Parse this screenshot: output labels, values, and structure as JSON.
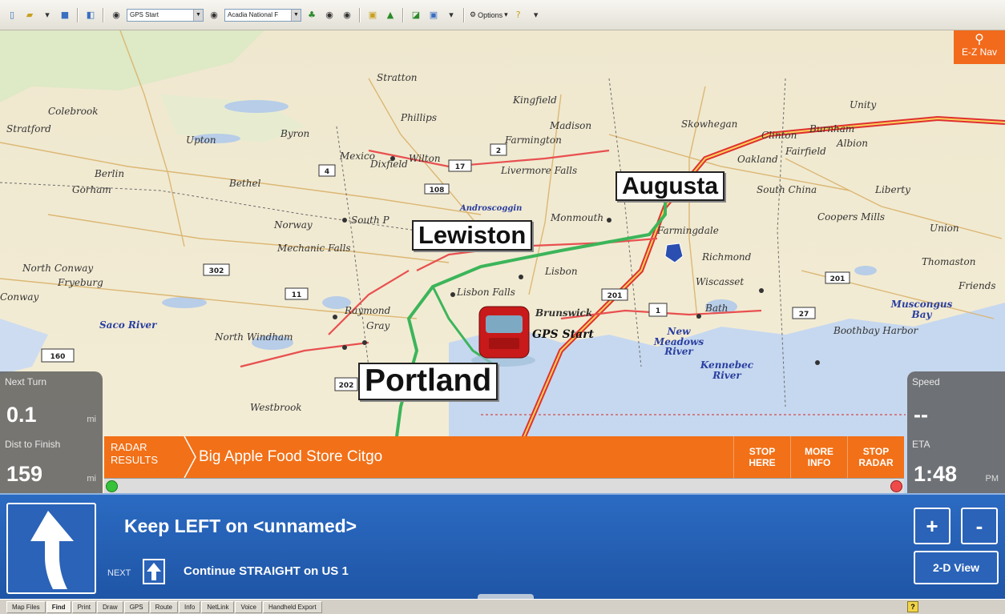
{
  "toolbar": {
    "gps_select": "GPS Start",
    "map_select": "Acadia National F",
    "options_label": "Options"
  },
  "map": {
    "ez_nav_label": "E-Z Nav",
    "cities": [
      "Augusta",
      "Lewiston",
      "Portland"
    ],
    "towns": [
      {
        "name": "Stratton"
      },
      {
        "name": "Kingfield"
      },
      {
        "name": "Phillips"
      },
      {
        "name": "Madison"
      },
      {
        "name": "Skowhegan"
      },
      {
        "name": "Farmington"
      },
      {
        "name": "Wilton"
      },
      {
        "name": "Dixfield"
      },
      {
        "name": "Livermore Falls"
      },
      {
        "name": "Mexico"
      },
      {
        "name": "Byron"
      },
      {
        "name": "Upton"
      },
      {
        "name": "Bethel"
      },
      {
        "name": "Gorham"
      },
      {
        "name": "Berlin"
      },
      {
        "name": "Norway"
      },
      {
        "name": "South P"
      },
      {
        "name": "Mechanic Falls"
      },
      {
        "name": "Monmouth"
      },
      {
        "name": "Farmingdale"
      },
      {
        "name": "Richmond"
      },
      {
        "name": "Lisbon"
      },
      {
        "name": "Lisbon Falls"
      },
      {
        "name": "Wiscasset"
      },
      {
        "name": "Raymond"
      },
      {
        "name": "Gray"
      },
      {
        "name": "North Windham"
      },
      {
        "name": "Bath"
      },
      {
        "name": "Boothbay Harbor"
      },
      {
        "name": "Westbrook"
      },
      {
        "name": "North Conway"
      },
      {
        "name": "Fryeburg"
      },
      {
        "name": "Conway"
      },
      {
        "name": "Colebrook"
      },
      {
        "name": "Oakland"
      },
      {
        "name": "Fairfield"
      },
      {
        "name": "Albion"
      },
      {
        "name": "South China"
      },
      {
        "name": "Liberty"
      },
      {
        "name": "Coopers Mills"
      },
      {
        "name": "Union"
      },
      {
        "name": "Thomaston"
      },
      {
        "name": "Friends"
      },
      {
        "name": "Unity"
      },
      {
        "name": "Clinton"
      },
      {
        "name": "Burnham"
      },
      {
        "name": "Stratford"
      },
      {
        "name": "Brunswick"
      }
    ],
    "water": [
      {
        "name": "Saco River"
      },
      {
        "name": "Androscoggin"
      },
      {
        "name": "New Meadows River"
      },
      {
        "name": "Kennebec River"
      },
      {
        "name": "Muscongus Bay"
      }
    ],
    "gps_marker_label": "GPS Start",
    "shields": [
      "302",
      "11",
      "202",
      "201",
      "1",
      "27",
      "160",
      "4",
      "17",
      "108",
      "2",
      "201"
    ]
  },
  "panels": {
    "next_turn": {
      "label": "Next Turn",
      "value": "0.1",
      "unit": "mi"
    },
    "dist_to_finish": {
      "label": "Dist to Finish",
      "value": "159",
      "unit": "mi"
    },
    "speed": {
      "label": "Speed",
      "value": "--"
    },
    "eta": {
      "label": "ETA",
      "value": "1:48",
      "unit": "PM"
    }
  },
  "radar": {
    "title_line1": "RADAR",
    "title_line2": "RESULTS",
    "result_name": "Big Apple Food Store Citgo",
    "buttons": [
      {
        "line1": "STOP",
        "line2": "HERE"
      },
      {
        "line1": "MORE",
        "line2": "INFO"
      },
      {
        "line1": "STOP",
        "line2": "RADAR"
      }
    ]
  },
  "directions": {
    "instruction": "Keep LEFT on <unnamed>",
    "next_label": "NEXT",
    "next_instruction": "Continue STRAIGHT on US 1",
    "zoom_in": "+",
    "zoom_out": "-",
    "view_toggle": "2-D View"
  },
  "status_tabs": [
    "Map Files",
    "Find",
    "Print",
    "Draw",
    "GPS",
    "Route",
    "Info",
    "NetLink",
    "Voice",
    "Handheld Export"
  ],
  "status_active_tab": "Find",
  "colors": {
    "radar_orange": "#f27017",
    "direction_blue": "#2b6bc2",
    "route_green": "#3cb55a"
  }
}
